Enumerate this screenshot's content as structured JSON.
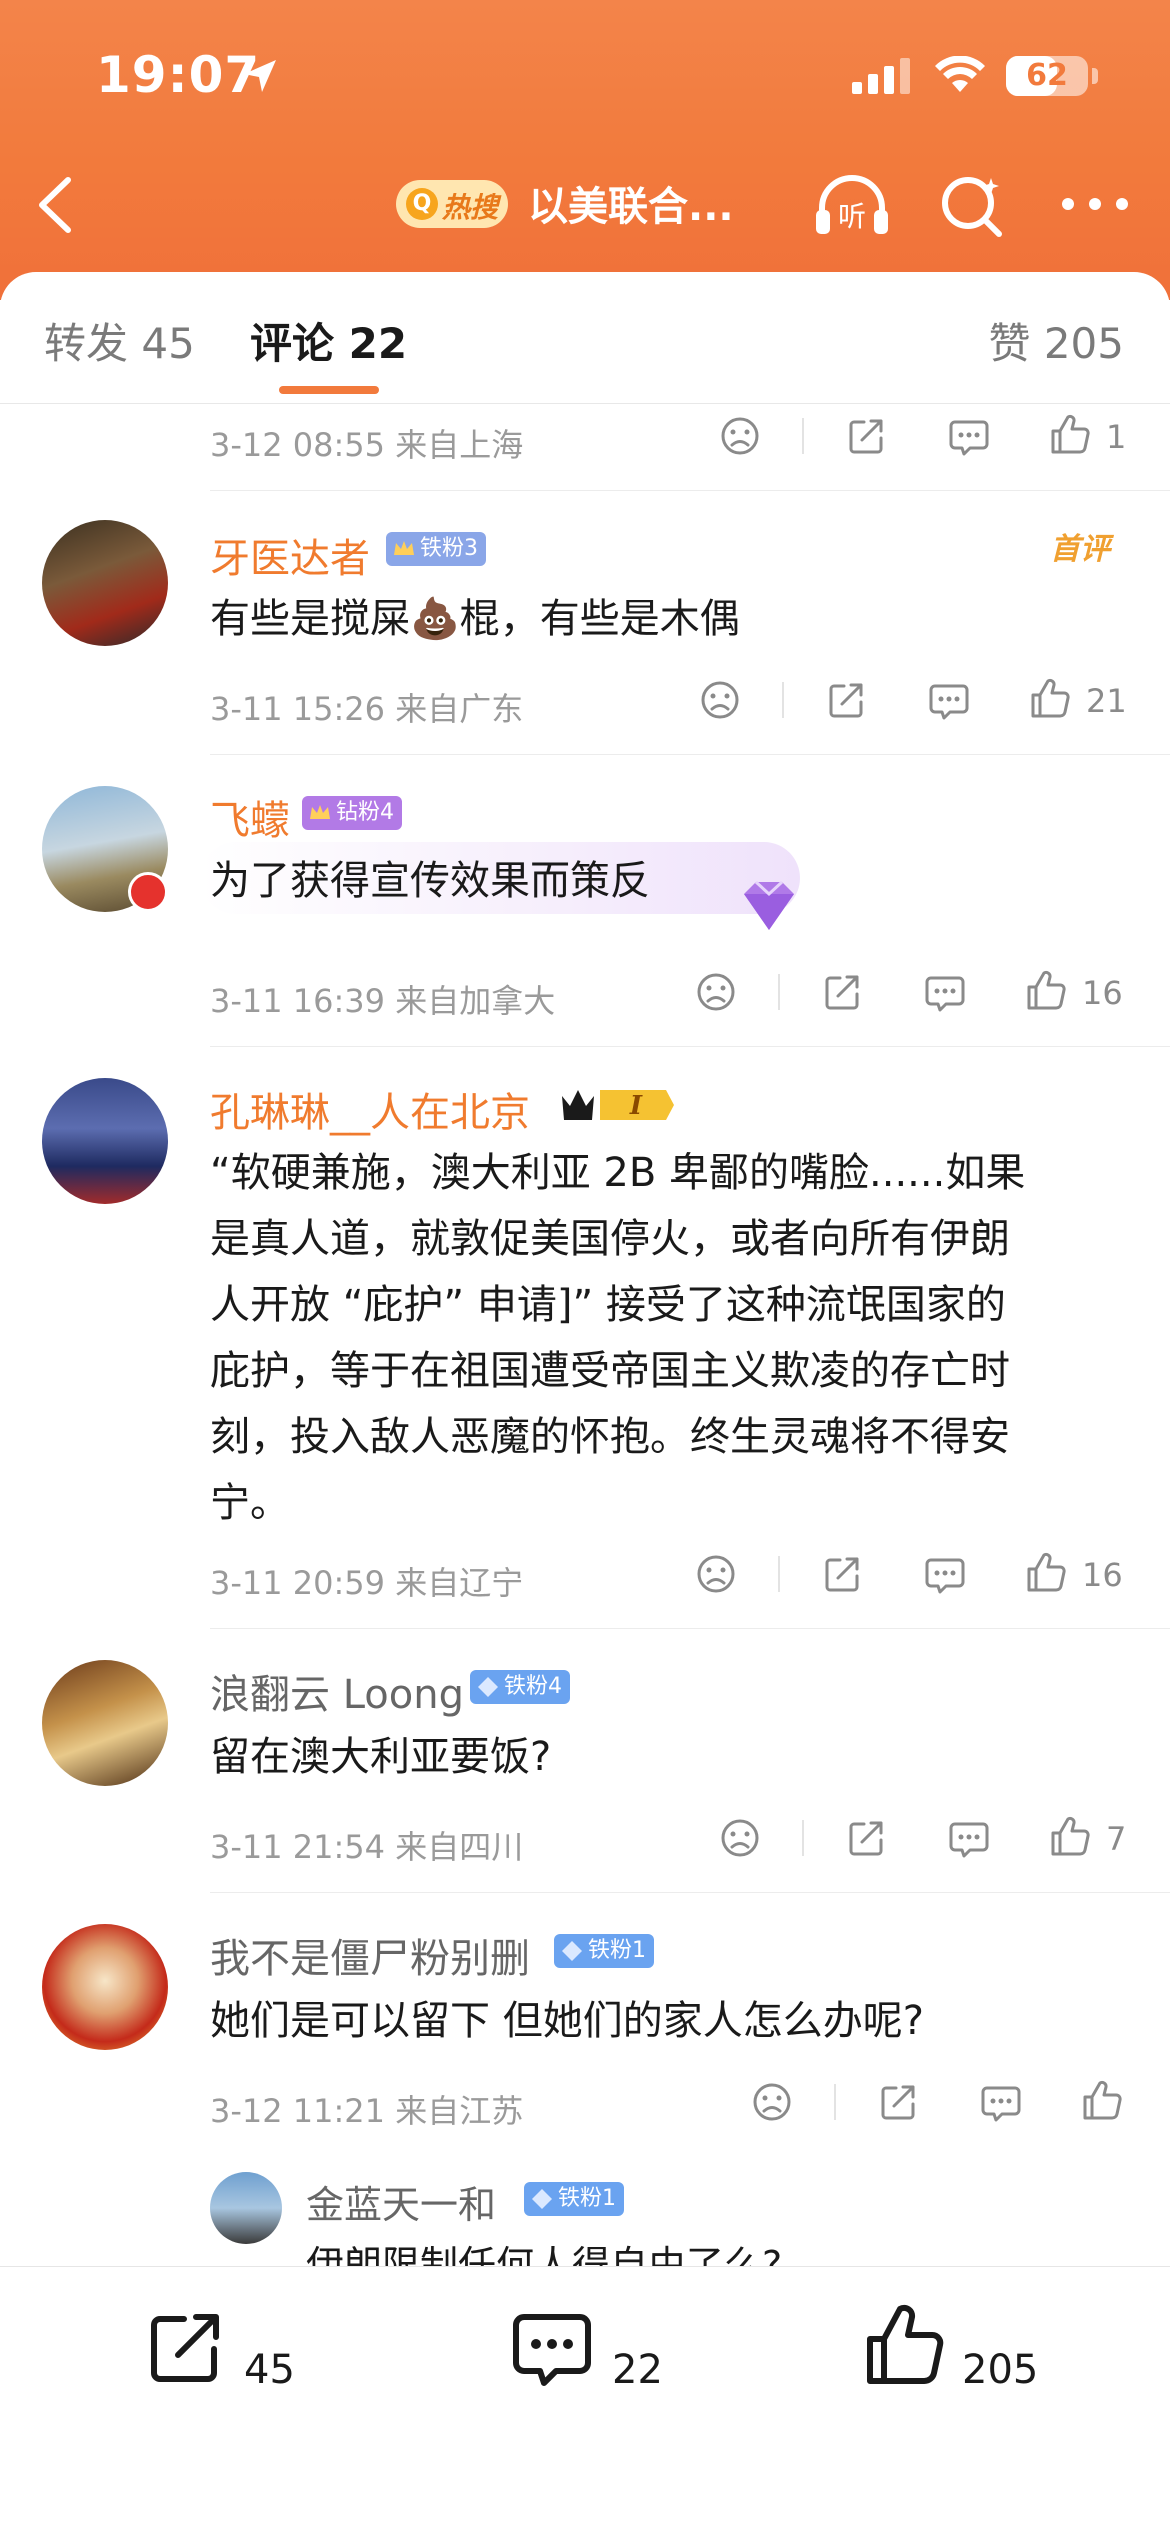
{
  "status_bar": {
    "time": "19:07",
    "battery": "62",
    "battery_level": 0.62
  },
  "nav": {
    "hot_badge": "热搜",
    "hot_badge_q": "Q",
    "title": "以美联合...",
    "listen_label": "听"
  },
  "tabs": {
    "repost": "转发 45",
    "comments": "评论 22",
    "likes": "赞 205"
  },
  "prev_comment": {
    "meta": "3-12 08:55  来自上海",
    "likes": "1"
  },
  "comments": [
    {
      "username": "牙医达者",
      "badge": "铁粉3",
      "first_tag": "首评",
      "text": "有些是搅屎💩棍，有些是木偶",
      "meta": "3-11 15:26  来自广东",
      "likes": "21"
    },
    {
      "username": "飞蠓",
      "badge": "钻粉4",
      "text": "为了获得宣传效果而策反",
      "meta": "3-11 16:39  来自加拿大",
      "likes": "16"
    },
    {
      "username": "孔琳琳__人在北京",
      "badge": "I",
      "text_lines": [
        "“软硬兼施，澳大利亚 2B 卑鄙的嘴脸......如果",
        "是真人道，就敦促美国停火，或者向所有伊朗",
        "人开放 “庇护” 申请]” 接受了这种流氓国家的",
        "庇护，等于在祖国遭受帝国主义欺凌的存亡时",
        "刻，投入敌人恶魔的怀抱。终生灵魂将不得安",
        "宁。"
      ],
      "meta": "3-11 20:59  来自辽宁",
      "likes": "16"
    },
    {
      "username": "浪翻云 Loong",
      "badge": "铁粉4",
      "text": "留在澳大利亚要饭?",
      "meta": "3-11 21:54  来自四川",
      "likes": "7"
    },
    {
      "username": "我不是僵尸粉别删",
      "badge": "铁粉1",
      "text": "她们是可以留下 但她们的家人怎么办呢?",
      "meta": "3-12 11:21  来自江苏",
      "likes": ""
    }
  ],
  "reply": {
    "username": "金蓝天一和",
    "badge": "铁粉1",
    "text": "伊朗限制任何人得自由了么?"
  },
  "bottom_bar": {
    "reposts": "45",
    "comments": "22",
    "likes": "205"
  },
  "colors": {
    "accent": "#f27a3c",
    "username_orange": "#f07b2e"
  },
  "icons": [
    "back-icon",
    "listen-icon",
    "search-icon",
    "more-icon",
    "sad-icon",
    "share-icon",
    "comment-icon",
    "like-icon"
  ]
}
